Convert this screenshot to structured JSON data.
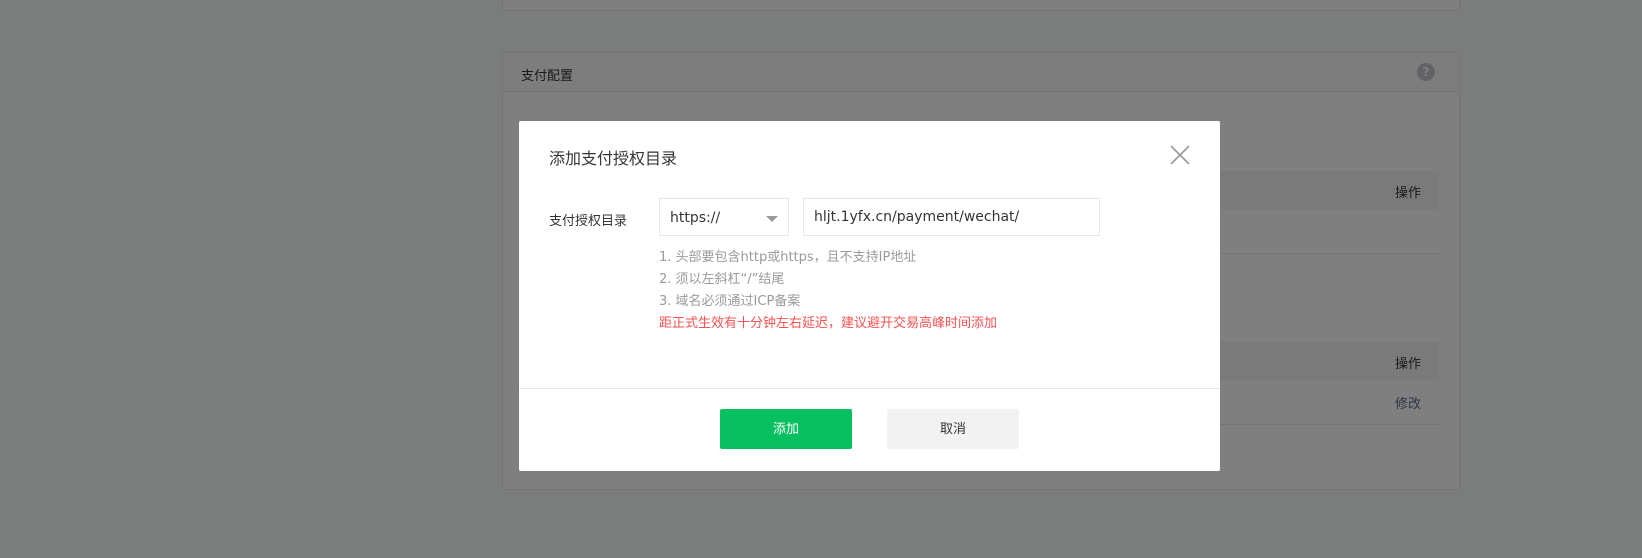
{
  "background": {
    "card_title": "支付配置",
    "help_icon": "question-icon",
    "table1_operation_header": "操作",
    "table2_operation_header": "操作",
    "table2_row_action": "修改"
  },
  "dialog": {
    "title": "添加支付授权目录",
    "close_icon": "close-icon",
    "label": "支付授权目录",
    "protocol_selected": "https://",
    "domain_value": "hljt.1yfx.cn/payment/wechat/",
    "tips": [
      "1. 头部要包含http或https，且不支持IP地址",
      "2. 须以左斜杠“/”结尾",
      "3. 域名必须通过ICP备案"
    ],
    "warning": "距正式生效有十分钟左右延迟，建议避开交易高峰时间添加",
    "confirm_label": "添加",
    "cancel_label": "取消"
  },
  "colors": {
    "accent": "#07c160",
    "warning": "#fa5151",
    "link": "#576b95"
  }
}
